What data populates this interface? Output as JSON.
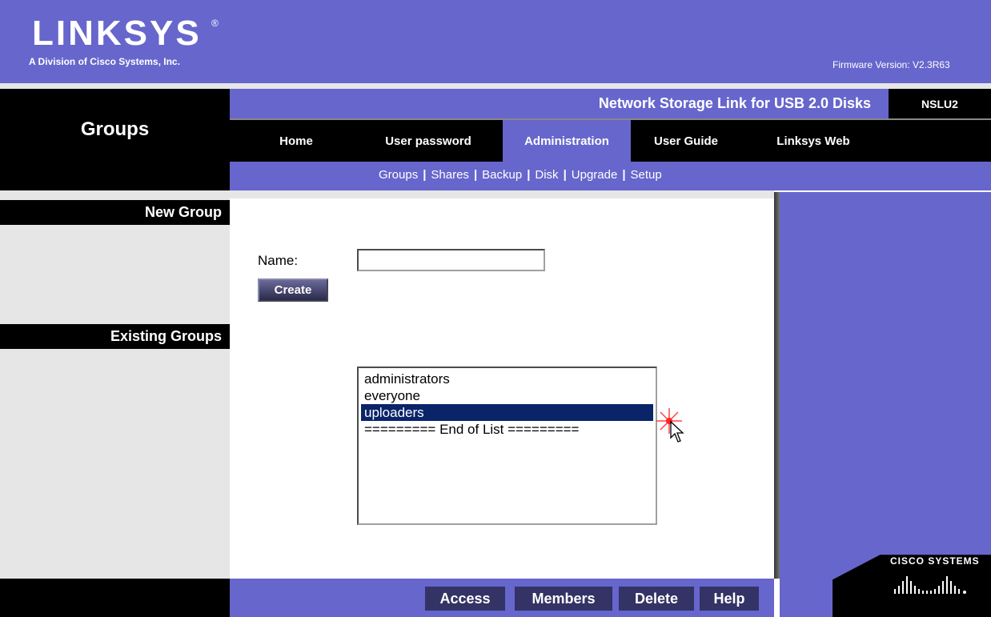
{
  "brand": {
    "logo_text": "LINKSYS",
    "logo_mark": "®",
    "subtitle": "A Division of Cisco Systems, Inc.",
    "firmware": "Firmware Version:  V2.3R63"
  },
  "page": {
    "title": "Groups"
  },
  "product": {
    "title": "Network Storage Link for USB 2.0 Disks",
    "model": "NSLU2"
  },
  "tabs": [
    {
      "label": "Home",
      "active": false
    },
    {
      "label": "User password",
      "active": false
    },
    {
      "label": "Administration",
      "active": true
    },
    {
      "label": "User Guide",
      "active": false
    },
    {
      "label": "Linksys Web",
      "active": false
    }
  ],
  "subnav": [
    "Groups",
    "Shares",
    "Backup",
    "Disk",
    "Upgrade",
    "Setup"
  ],
  "subnav_sep": "|",
  "sections": {
    "new_group": "New Group",
    "existing_groups": "Existing Groups"
  },
  "form": {
    "name_label": "Name:",
    "name_value": "",
    "create_label": "Create"
  },
  "groups_list": {
    "items": [
      "administrators",
      "everyone",
      "uploaders",
      "========= End of List ========="
    ],
    "selected_index": 2
  },
  "actions": {
    "access": "Access",
    "members": "Members",
    "delete": "Delete",
    "help": "Help"
  },
  "footer_brand": "CISCO SYSTEMS",
  "colors": {
    "brand_purple": "#6666cc",
    "black": "#000000",
    "selection": "#0a246a",
    "panel_grey": "#e6e6e6"
  }
}
